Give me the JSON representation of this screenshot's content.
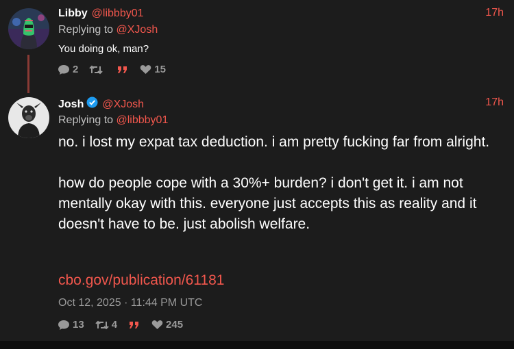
{
  "reply_tweet": {
    "display_name": "Libby",
    "handle": "@libbby01",
    "time": "17h",
    "replying_prefix": "Replying to",
    "replying_handle": "@XJosh",
    "text": "You doing ok, man?",
    "reply_count": "2",
    "retweet_count": "",
    "like_count": "15"
  },
  "main_tweet": {
    "display_name": "Josh",
    "verified": true,
    "handle": "@XJosh",
    "time": "17h",
    "replying_prefix": "Replying to",
    "replying_handle": "@libbby01",
    "paragraph1": "no. i lost my expat tax deduction. i am pretty fucking far from alright.",
    "paragraph2": "how do people cope with a 30%+ burden? i don't get it. i am not mentally okay with this. everyone just accepts this as reality and it doesn't have to be. just abolish welfare.",
    "link": "cbo.gov/publication/61181",
    "timestamp": "Oct 12, 2025 · 11:44 PM UTC",
    "reply_count": "13",
    "retweet_count": "4",
    "like_count": "245"
  },
  "colors": {
    "accent": "#f2574d",
    "muted": "#9a9a9a",
    "background": "#1c1c1c",
    "verified_badge": "#1d9bf0"
  },
  "icons": {
    "reply": "comment-bubble-icon",
    "retweet": "retweet-icon",
    "quote": "quote-icon",
    "like": "heart-icon",
    "verified": "verified-badge-icon"
  }
}
